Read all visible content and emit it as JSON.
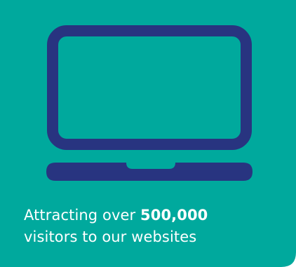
{
  "card": {
    "background_color": "#00A99D",
    "icon": "laptop-icon",
    "icon_color": "#283480",
    "caption": {
      "line1_prefix": "Attracting over ",
      "line1_number": "500,000",
      "line2": "visitors to our websites"
    }
  }
}
